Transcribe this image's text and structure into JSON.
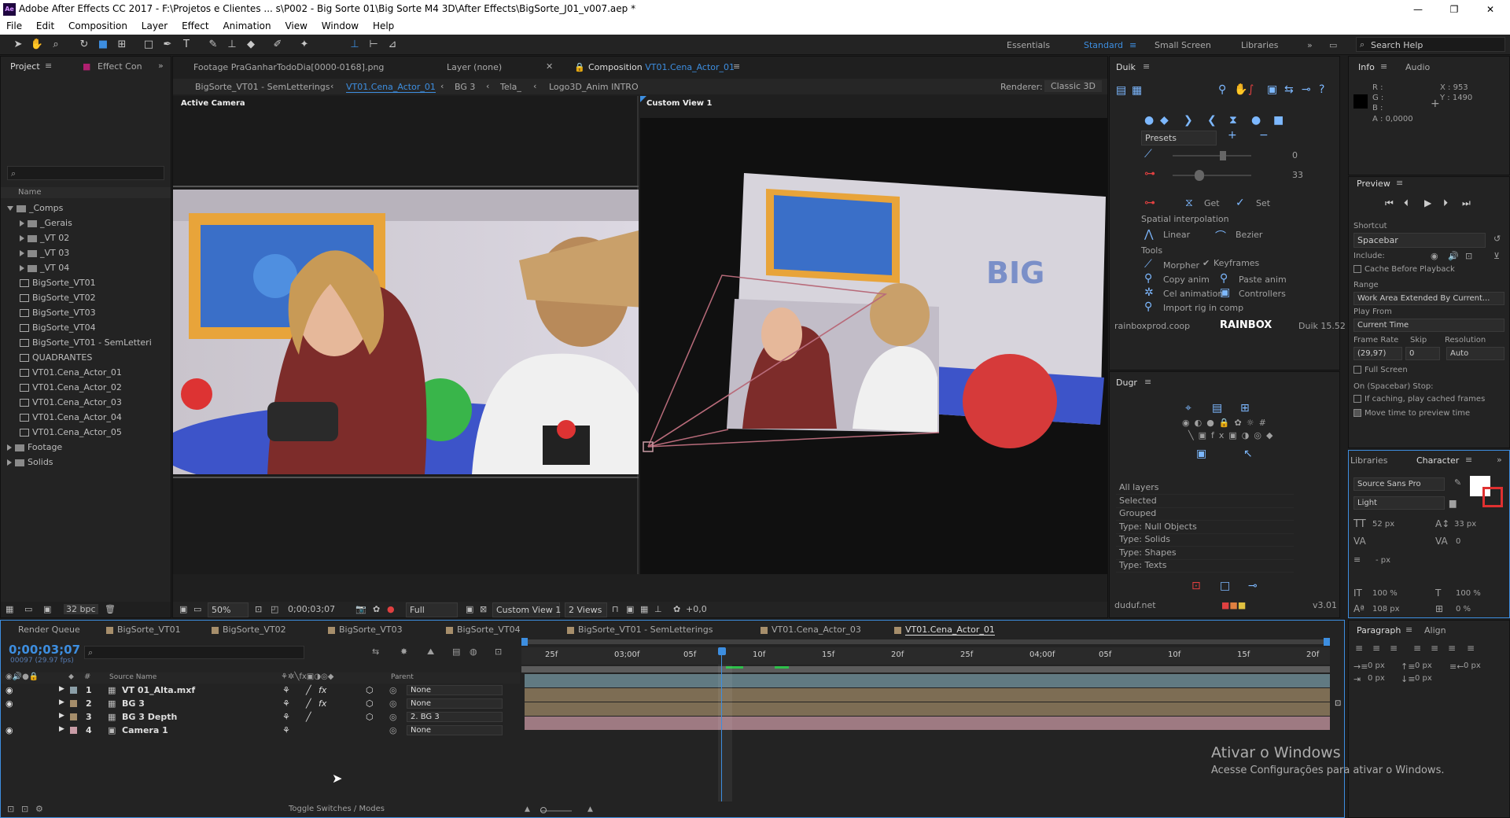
{
  "title": "Adobe After Effects CC 2017 - F:\\Projetos e Clientes ... s\\P002 - Big Sorte 01\\Big Sorte M4 3D\\After Effects\\BigSorte_J01_v007.aep *",
  "menu": [
    "File",
    "Edit",
    "Composition",
    "Layer",
    "Effect",
    "Animation",
    "View",
    "Window",
    "Help"
  ],
  "workspaces": [
    "Essentials",
    "Standard",
    "Small Screen",
    "Libraries"
  ],
  "search_help": "Search Help",
  "project": {
    "tabs": [
      "Project",
      "Effect Con"
    ],
    "search_placeholder": "⌕",
    "col_name": "Name",
    "items": [
      {
        "name": "_Comps",
        "type": "folder",
        "open": true,
        "indent": 0
      },
      {
        "name": "_Gerais",
        "type": "folder",
        "indent": 1
      },
      {
        "name": "_VT 02",
        "type": "folder",
        "indent": 1
      },
      {
        "name": "_VT 03",
        "type": "folder",
        "indent": 1
      },
      {
        "name": "_VT 04",
        "type": "folder",
        "indent": 1
      },
      {
        "name": "BigSorte_VT01",
        "type": "comp",
        "indent": 1
      },
      {
        "name": "BigSorte_VT02",
        "type": "comp",
        "indent": 1
      },
      {
        "name": "BigSorte_VT03",
        "type": "comp",
        "indent": 1
      },
      {
        "name": "BigSorte_VT04",
        "type": "comp",
        "indent": 1
      },
      {
        "name": "BigSorte_VT01 - SemLetteri",
        "type": "comp",
        "indent": 1
      },
      {
        "name": "QUADRANTES",
        "type": "comp",
        "indent": 1
      },
      {
        "name": "VT01.Cena_Actor_01",
        "type": "comp",
        "indent": 1
      },
      {
        "name": "VT01.Cena_Actor_02",
        "type": "comp",
        "indent": 1
      },
      {
        "name": "VT01.Cena_Actor_03",
        "type": "comp",
        "indent": 1
      },
      {
        "name": "VT01.Cena_Actor_04",
        "type": "comp",
        "indent": 1
      },
      {
        "name": "VT01.Cena_Actor_05",
        "type": "comp",
        "indent": 1
      },
      {
        "name": "Footage",
        "type": "folder",
        "indent": 0
      },
      {
        "name": "Solids",
        "type": "folder",
        "indent": 0
      }
    ],
    "bpc": "32 bpc"
  },
  "viewer": {
    "tabs": [
      "Footage PraGanharTodoDia[0000-0168].png",
      "Layer (none)",
      "Composition VT01.Cena_Actor_01"
    ],
    "comp_name": "VT01.Cena_Actor_01",
    "breadcrumbs": [
      "BigSorte_VT01 - SemLetterings",
      "VT01.Cena_Actor_01",
      "BG 3",
      "Tela_",
      "Logo3D_Anim INTRO"
    ],
    "renderer_label": "Renderer:",
    "renderer": "Classic 3D",
    "view1": "Active Camera",
    "view2": "Custom View 1",
    "zoom": "50%",
    "timecode": "0;00;03;07",
    "resolution": "Full",
    "view_select": "Custom View 1",
    "views": "2 Views",
    "exposure": "+0,0"
  },
  "duik": {
    "title": "Duik",
    "presets": "Presets",
    "slider1": "0",
    "slider2": "33",
    "get": "Get",
    "set": "Set",
    "spatial": "Spatial interpolation",
    "linear": "Linear",
    "bezier": "Bezier",
    "tools_label": "Tools",
    "tools": [
      "Morpher",
      "Keyframes",
      "Copy anim",
      "Paste anim",
      "Cel animation",
      "Controllers",
      "Import rig in comp"
    ],
    "site": "rainboxprod.coop",
    "version": "Duik 15.52"
  },
  "dugr": {
    "title": "Dugr",
    "items": [
      "All layers",
      "Selected",
      "Grouped",
      "Type: Null Objects",
      "Type: Solids",
      "Type: Shapes",
      "Type: Texts"
    ],
    "site": "duduf.net",
    "version": "v3.01"
  },
  "info": {
    "tabs": [
      "Info",
      "Audio"
    ],
    "r": "R :",
    "g": "G :",
    "b": "B :",
    "a": "A : 0,0000",
    "x": "X : 953",
    "y": "Y : 1490"
  },
  "preview": {
    "title": "Preview",
    "shortcut_label": "Shortcut",
    "shortcut": "Spacebar",
    "include_label": "Include:",
    "cache": "Cache Before Playback",
    "range_label": "Range",
    "range": "Work Area Extended By Current...",
    "playfrom_label": "Play From",
    "playfrom": "Current Time",
    "framerate_label": "Frame Rate",
    "skip_label": "Skip",
    "resolution_label": "Resolution",
    "framerate": "(29,97)",
    "skip": "0",
    "resolution": "Auto",
    "fullscreen": "Full Screen",
    "onstop": "On (Spacebar) Stop:",
    "ifcaching": "If caching, play cached frames",
    "movetime": "Move time to preview time"
  },
  "character": {
    "tabs": [
      "Libraries",
      "Character"
    ],
    "font": "Source Sans Pro",
    "style": "Light",
    "size": "52 px",
    "leading": "33 px",
    "tracking": "0",
    "px": "- px",
    "vscale": "100 %",
    "hscale": "100 %",
    "baseline": "108 px",
    "tsume": "0 %"
  },
  "paragraph": {
    "tabs": [
      "Paragraph",
      "Align"
    ],
    "v1": "0 px",
    "v2": "0 px",
    "v3": "0 px",
    "v4": "0 px",
    "v5": "0 px"
  },
  "timeline": {
    "tabs": [
      "Render Queue",
      "BigSorte_VT01",
      "BigSorte_VT02",
      "BigSorte_VT03",
      "BigSorte_VT04",
      "BigSorte_VT01 - SemLetterings",
      "VT01.Cena_Actor_03",
      "VT01.Cena_Actor_01"
    ],
    "timecode": "0;00;03;07",
    "frames": "00097 (29.97 fps)",
    "search_placeholder": "⌕",
    "col_source": "Source Name",
    "col_parent": "Parent",
    "layers": [
      {
        "num": "1",
        "name": "VT 01_Alta.mxf",
        "parent": "None",
        "color": "#8b9fa8"
      },
      {
        "num": "2",
        "name": "BG 3",
        "parent": "None",
        "color": "#a68e6b"
      },
      {
        "num": "3",
        "name": "BG 3 Depth",
        "parent": "2. BG 3",
        "color": "#a68e6b"
      },
      {
        "num": "4",
        "name": "Camera 1",
        "parent": "None",
        "color": "#c99ca6"
      }
    ],
    "ruler": [
      "25f",
      "03;00f",
      "05f",
      "10f",
      "15f",
      "20f",
      "25f",
      "04;00f",
      "05f",
      "10f",
      "15f",
      "20f"
    ],
    "toggle": "Toggle Switches / Modes"
  },
  "watermark": {
    "line1": "Ativar o Windows",
    "line2": "Acesse Configurações para ativar o Windows."
  }
}
